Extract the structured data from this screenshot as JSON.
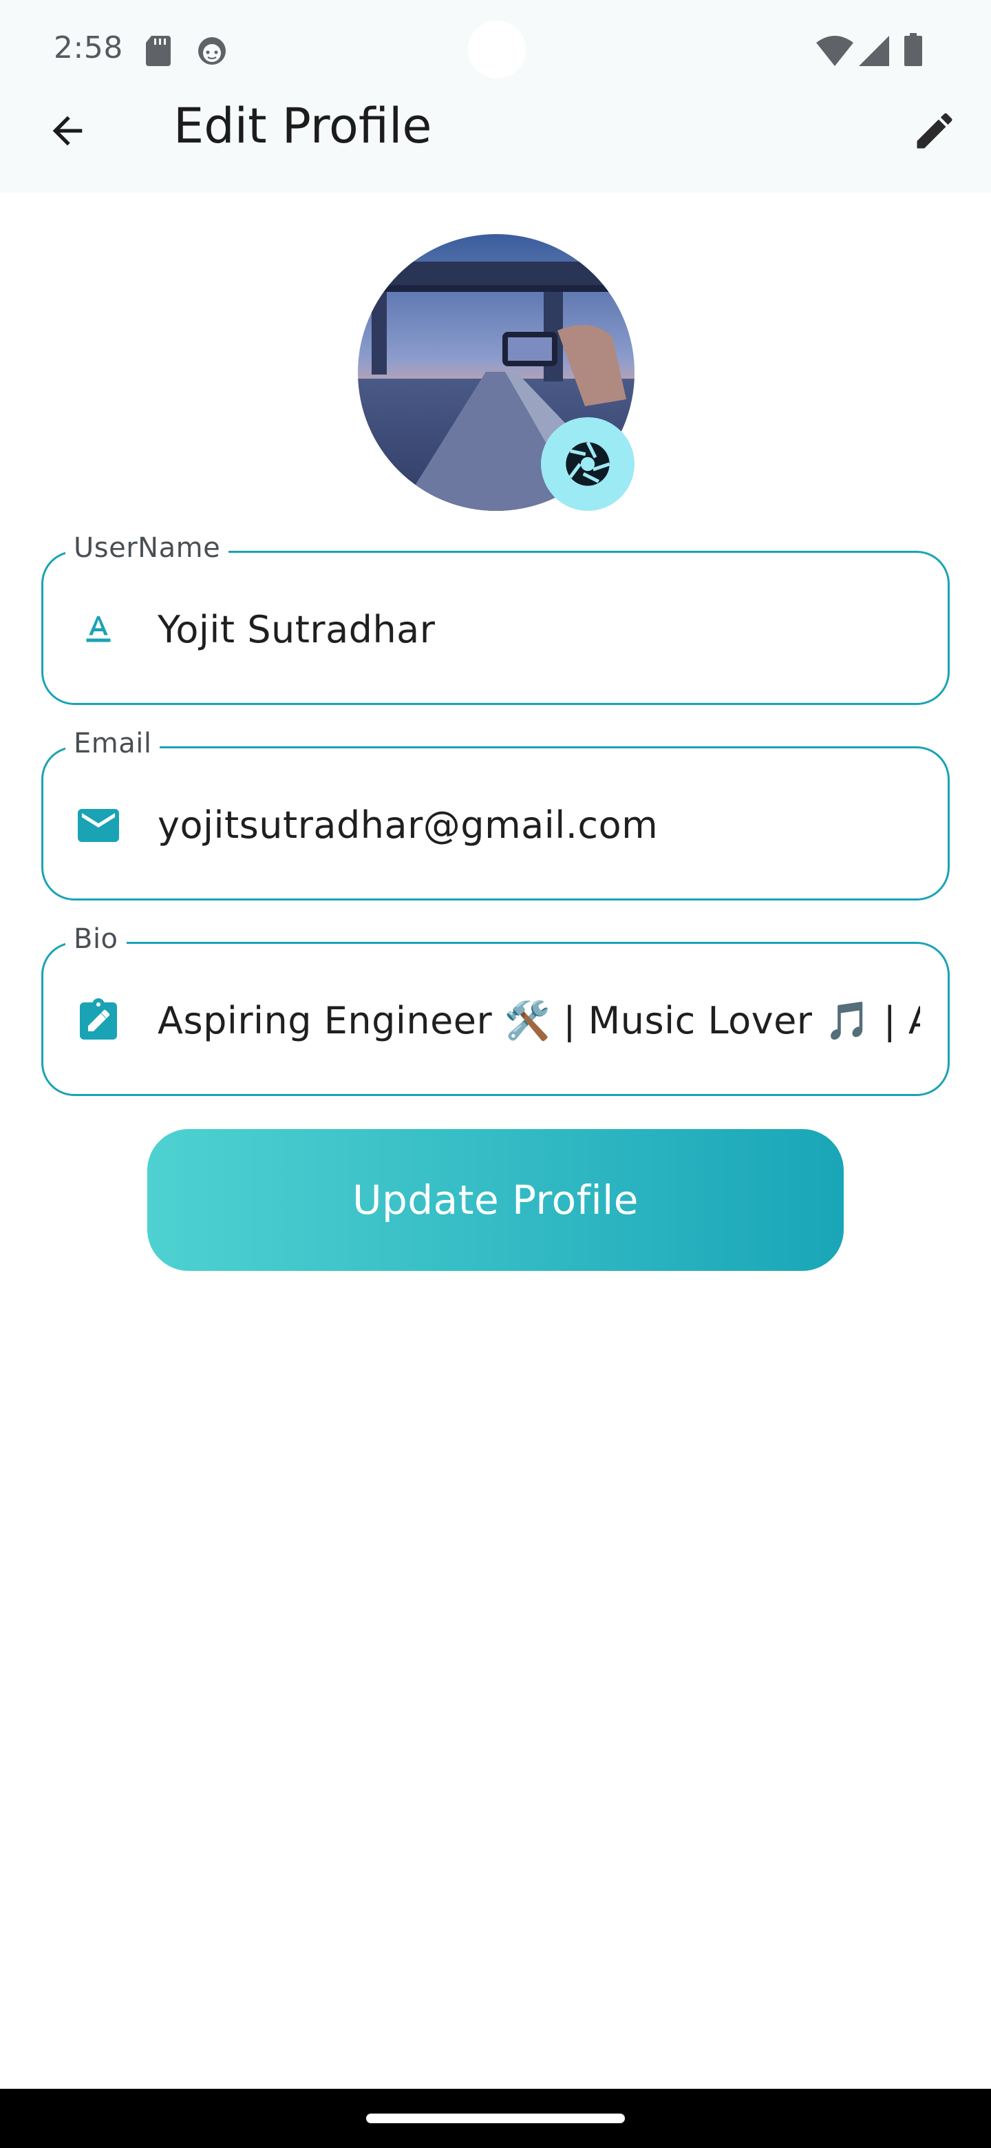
{
  "status_bar": {
    "time": "2:58",
    "icons": [
      "sd-card-icon",
      "face-icon",
      "wifi-icon",
      "signal-icon",
      "battery-icon"
    ]
  },
  "app_bar": {
    "title": "Edit Profile",
    "back_icon": "arrow-back-icon",
    "edit_icon": "pencil-icon"
  },
  "avatar": {
    "camera_icon": "camera-shutter-icon"
  },
  "form": {
    "username": {
      "label": "UserName",
      "value": "Yojit Sutradhar",
      "icon": "text-format-icon"
    },
    "email": {
      "label": "Email",
      "value": "yojitsutradhar@gmail.com",
      "icon": "mail-icon"
    },
    "bio": {
      "label": "Bio",
      "value": "Aspiring Engineer 🛠️ | Music Lover 🎵 | Avid Reader",
      "icon": "clipboard-edit-icon"
    },
    "submit_label": "Update Profile"
  },
  "colors": {
    "accent": "#1aa3b4",
    "button_gradient_start": "#4fd1d1",
    "button_gradient_end": "#1aa6b8",
    "camera_badge": "#9ceaf4"
  }
}
